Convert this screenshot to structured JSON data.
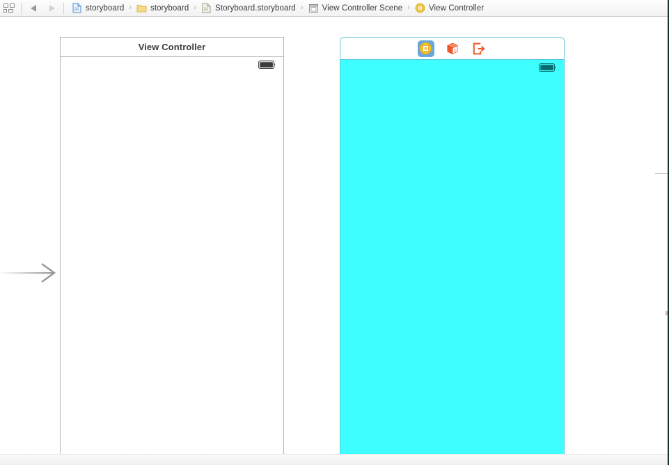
{
  "jumpbar": {
    "grid_button": {
      "icon": "grid-squares-icon",
      "label": "Related Items"
    },
    "back_button": {
      "icon": "triangle-left-icon",
      "label": "Go Back",
      "enabled": true
    },
    "forward_button": {
      "icon": "triangle-right-icon",
      "label": "Go Forward",
      "enabled": false
    },
    "breadcrumbs": [
      {
        "icon": "project-document-icon",
        "label": "storyboard"
      },
      {
        "icon": "folder-icon",
        "label": "storyboard"
      },
      {
        "icon": "storyboard-file-icon",
        "label": "Storyboard.storyboard"
      },
      {
        "icon": "scene-icon",
        "label": "View Controller Scene"
      },
      {
        "icon": "view-controller-icon",
        "label": "View Controller"
      }
    ],
    "separator": "›"
  },
  "canvas": {
    "entry_point": {
      "icon": "entry-point-arrow-icon",
      "label": "Storyboard Entry Point"
    },
    "scenes": [
      {
        "id": "scene-left",
        "title": "View Controller",
        "view_background_color": "#FFFFFF",
        "status_bar": {
          "battery_icon": "battery-icon",
          "battery_color": "#333333"
        }
      },
      {
        "id": "scene-right",
        "title": "",
        "selected": true,
        "view_background_color": "#3FFEFF",
        "status_bar": {
          "battery_icon": "battery-icon",
          "battery_color": "#0B6A6E"
        },
        "dock_items": [
          {
            "icon": "view-controller-icon",
            "label": "View Controller",
            "selected": true
          },
          {
            "icon": "first-responder-cube-icon",
            "label": "First Responder",
            "selected": false
          },
          {
            "icon": "exit-icon",
            "label": "Exit",
            "selected": false
          }
        ]
      }
    ]
  },
  "colors": {
    "selection_blue": "#6AA6DE",
    "scene_border_selected": "#56C9E2",
    "scene_border_plain": "#B4B4B4",
    "accent_orange": "#F2592A",
    "accent_yellow": "#F2C230",
    "canvas_background": "#FFFFFF"
  }
}
